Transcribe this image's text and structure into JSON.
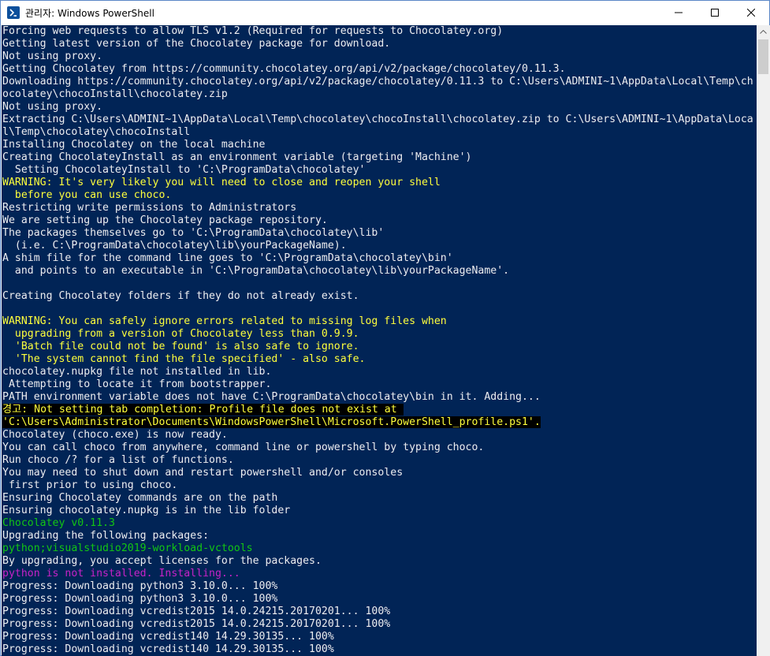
{
  "window": {
    "title": "관리자: Windows PowerShell",
    "icon": "powershell-icon",
    "buttons": {
      "minimize": "minimize-icon",
      "maximize": "maximize-icon",
      "close": "close-icon"
    }
  },
  "colors": {
    "console_bg": "#012456",
    "text": "#eeedf0",
    "warning": "#ffff3c",
    "success": "#13c613",
    "highlight": "#c822c8"
  },
  "console": {
    "lines": [
      {
        "style": "white",
        "text": "Forcing web requests to allow TLS v1.2 (Required for requests to Chocolatey.org)"
      },
      {
        "style": "white",
        "text": "Getting latest version of the Chocolatey package for download."
      },
      {
        "style": "white",
        "text": "Not using proxy."
      },
      {
        "style": "white",
        "text": "Getting Chocolatey from https://community.chocolatey.org/api/v2/package/chocolatey/0.11.3."
      },
      {
        "style": "white",
        "text": "Downloading https://community.chocolatey.org/api/v2/package/chocolatey/0.11.3 to C:\\Users\\ADMINI~1\\AppData\\Local\\Temp\\ch"
      },
      {
        "style": "white",
        "text": "ocolatey\\chocoInstall\\chocolatey.zip"
      },
      {
        "style": "white",
        "text": "Not using proxy."
      },
      {
        "style": "white",
        "text": "Extracting C:\\Users\\ADMINI~1\\AppData\\Local\\Temp\\chocolatey\\chocoInstall\\chocolatey.zip to C:\\Users\\ADMINI~1\\AppData\\Loca"
      },
      {
        "style": "white",
        "text": "l\\Temp\\chocolatey\\chocoInstall"
      },
      {
        "style": "white",
        "text": "Installing Chocolatey on the local machine"
      },
      {
        "style": "white",
        "text": "Creating ChocolateyInstall as an environment variable (targeting 'Machine')"
      },
      {
        "style": "white",
        "text": "  Setting ChocolateyInstall to 'C:\\ProgramData\\chocolatey'"
      },
      {
        "style": "yellow",
        "text": "WARNING: It's very likely you will need to close and reopen your shell"
      },
      {
        "style": "yellow",
        "text": "  before you can use choco."
      },
      {
        "style": "white",
        "text": "Restricting write permissions to Administrators"
      },
      {
        "style": "white",
        "text": "We are setting up the Chocolatey package repository."
      },
      {
        "style": "white",
        "text": "The packages themselves go to 'C:\\ProgramData\\chocolatey\\lib'"
      },
      {
        "style": "white",
        "text": "  (i.e. C:\\ProgramData\\chocolatey\\lib\\yourPackageName)."
      },
      {
        "style": "white",
        "text": "A shim file for the command line goes to 'C:\\ProgramData\\chocolatey\\bin'"
      },
      {
        "style": "white",
        "text": "  and points to an executable in 'C:\\ProgramData\\chocolatey\\lib\\yourPackageName'."
      },
      {
        "style": "white",
        "text": ""
      },
      {
        "style": "white",
        "text": "Creating Chocolatey folders if they do not already exist."
      },
      {
        "style": "white",
        "text": ""
      },
      {
        "style": "yellow",
        "text": "WARNING: You can safely ignore errors related to missing log files when"
      },
      {
        "style": "yellow",
        "text": "  upgrading from a version of Chocolatey less than 0.9.9."
      },
      {
        "style": "yellow",
        "text": "  'Batch file could not be found' is also safe to ignore."
      },
      {
        "style": "yellow",
        "text": "  'The system cannot find the file specified' - also safe."
      },
      {
        "style": "white",
        "text": "chocolatey.nupkg file not installed in lib."
      },
      {
        "style": "white",
        "text": " Attempting to locate it from bootstrapper."
      },
      {
        "style": "white",
        "text": "PATH environment variable does not have C:\\ProgramData\\chocolatey\\bin in it. Adding..."
      },
      {
        "style": "warnhl",
        "text": "경고: Not setting tab completion: Profile file does not exist at "
      },
      {
        "style": "warnhl",
        "text": "'C:\\Users\\Administrator\\Documents\\WindowsPowerShell\\Microsoft.PowerShell_profile.ps1'."
      },
      {
        "style": "white",
        "text": "Chocolatey (choco.exe) is now ready."
      },
      {
        "style": "white",
        "text": "You can call choco from anywhere, command line or powershell by typing choco."
      },
      {
        "style": "white",
        "text": "Run choco /? for a list of functions."
      },
      {
        "style": "white",
        "text": "You may need to shut down and restart powershell and/or consoles"
      },
      {
        "style": "white",
        "text": " first prior to using choco."
      },
      {
        "style": "white",
        "text": "Ensuring Chocolatey commands are on the path"
      },
      {
        "style": "white",
        "text": "Ensuring chocolatey.nupkg is in the lib folder"
      },
      {
        "style": "green",
        "text": "Chocolatey v0.11.3"
      },
      {
        "style": "white",
        "text": "Upgrading the following packages:"
      },
      {
        "style": "green",
        "text": "python;visualstudio2019-workload-vctools"
      },
      {
        "style": "white",
        "text": "By upgrading, you accept licenses for the packages."
      },
      {
        "style": "magenta",
        "text": "python is not installed. Installing..."
      },
      {
        "style": "white",
        "text": "Progress: Downloading python3 3.10.0... 100%"
      },
      {
        "style": "white",
        "text": "Progress: Downloading python3 3.10.0... 100%"
      },
      {
        "style": "white",
        "text": "Progress: Downloading vcredist2015 14.0.24215.20170201... 100%"
      },
      {
        "style": "white",
        "text": "Progress: Downloading vcredist2015 14.0.24215.20170201... 100%"
      },
      {
        "style": "white",
        "text": "Progress: Downloading vcredist140 14.29.30135... 100%"
      },
      {
        "style": "white",
        "text": "Progress: Downloading vcredist140 14.29.30135... 100%"
      }
    ]
  }
}
